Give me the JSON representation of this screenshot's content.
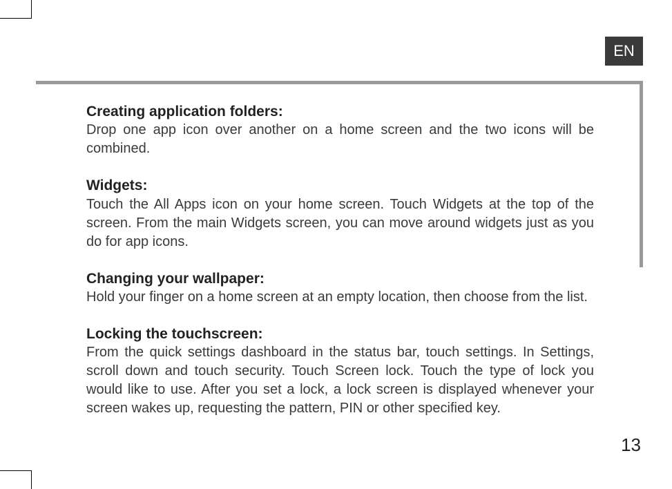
{
  "lang_tab": "EN",
  "sections": [
    {
      "heading": "Creating application folders:",
      "body": "Drop one app icon over another on a home screen and the two icons will be combined."
    },
    {
      "heading": "Widgets:",
      "body": "Touch the All Apps icon on your home screen. Touch Widgets at the top of the screen. From the main Widgets screen, you can move around widgets just as you do for app icons."
    },
    {
      "heading": "Changing your wallpaper:",
      "body": "Hold your finger on a home screen at an empty location, then choose from the list."
    },
    {
      "heading": "Locking the touchscreen:",
      "body": "From the quick settings dashboard in the status bar, touch settings. In Settings, scroll down and touch security. Touch Screen lock. Touch the type of lock you would like to use. After you set a lock, a lock screen is displayed whenever your screen wakes up, requesting the pattern, PIN or other specified key."
    }
  ],
  "page_number": "13"
}
